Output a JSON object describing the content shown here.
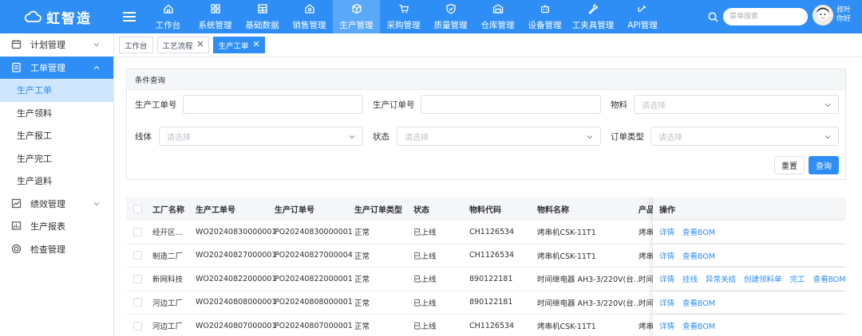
{
  "brand": {
    "name": "虹智造"
  },
  "nav": [
    {
      "label": "工作台",
      "icon": "home-icon"
    },
    {
      "label": "系统管理",
      "icon": "grid-icon"
    },
    {
      "label": "基础数据",
      "icon": "table-icon"
    },
    {
      "label": "销售管理",
      "icon": "store-icon"
    },
    {
      "label": "生产管理",
      "icon": "cube-icon"
    },
    {
      "label": "采购管理",
      "icon": "cart-icon"
    },
    {
      "label": "质量管理",
      "icon": "shield-icon"
    },
    {
      "label": "仓库管理",
      "icon": "warehouse-icon"
    },
    {
      "label": "设备管理",
      "icon": "robot-icon"
    },
    {
      "label": "工夹具管理",
      "icon": "wrench-icon"
    },
    {
      "label": "API管理",
      "icon": "satellite-icon"
    }
  ],
  "search": {
    "placeholder": "菜单搜索"
  },
  "user": {
    "line1": "叔叶",
    "line2": "你好"
  },
  "sidebar": {
    "groups": [
      {
        "label": "计划管理",
        "icon": "calendar-icon",
        "expandable": true
      },
      {
        "label": "工单管理",
        "icon": "document-icon",
        "expandable": true,
        "open": true,
        "children": [
          "生产工单",
          "生产领料",
          "生产报工",
          "生产完工",
          "生产退料"
        ]
      },
      {
        "label": "绩效管理",
        "icon": "chart-icon",
        "expandable": true
      },
      {
        "label": "生产报表",
        "icon": "report-icon",
        "expandable": false
      },
      {
        "label": "检查管理",
        "icon": "target-icon",
        "expandable": false
      }
    ]
  },
  "tabs": [
    {
      "label": "工作台",
      "closable": false,
      "active": false
    },
    {
      "label": "工艺流程",
      "closable": true,
      "active": false
    },
    {
      "label": "生产工单",
      "closable": true,
      "active": true
    }
  ],
  "filter": {
    "title": "条件查询",
    "work_order_label": "生产工单号",
    "prod_order_label": "生产订单号",
    "material_label": "物料",
    "material_placeholder": "请选择",
    "line_label": "线体",
    "line_placeholder": "请选择",
    "status_label": "状态",
    "status_placeholder": "请选择",
    "order_type_label": "订单类型",
    "order_type_placeholder": "请选择",
    "reset": "重置",
    "query": "查询"
  },
  "table": {
    "columns": [
      "工厂名称",
      "生产工单号",
      "生产订单号",
      "生产订单类型",
      "状态",
      "物料代码",
      "物料名称",
      "产品",
      "操作"
    ],
    "rows": [
      {
        "factory": "经开区...",
        "wo": "WO20240830000001",
        "po": "PO20240830000001",
        "type": "正常",
        "status": "已上线",
        "code": "CH1126534",
        "name": "烤串机CSK-11T1",
        "product": "烤串机",
        "actions": [
          "详情",
          "查看BOM"
        ]
      },
      {
        "factory": "制造二厂",
        "wo": "WO20240827000001",
        "po": "PO20240827000004",
        "type": "正常",
        "status": "已上线",
        "code": "CH1126534",
        "name": "烤串机CSK-11T1",
        "product": "烤串机",
        "actions": [
          "详情",
          "查看BOM"
        ]
      },
      {
        "factory": "新网科技",
        "wo": "WO20240822000001",
        "po": "PO20240822000001",
        "type": "正常",
        "status": "已上线",
        "code": "890122181",
        "name": "时间继电器 AH3-3/220V(台...",
        "product": "时间继",
        "actions": [
          "详情",
          "挂线",
          "异常关结",
          "创建领料单",
          "完工",
          "查看BOM"
        ]
      },
      {
        "factory": "河边工厂",
        "wo": "WO20240808000001",
        "po": "PO20240808000001",
        "type": "正常",
        "status": "已上线",
        "code": "890122181",
        "name": "时间继电器 AH3-3/220V(台...",
        "product": "时间继",
        "actions": [
          "详情",
          "查看BOM"
        ]
      },
      {
        "factory": "河边工厂",
        "wo": "WO20240807000001",
        "po": "PO20240807000001",
        "type": "正常",
        "status": "已上线",
        "code": "CH1126534",
        "name": "烤串机CSK-11T1",
        "product": "烤串机",
        "actions": [
          "详情",
          "查看BOM"
        ]
      }
    ]
  },
  "colors": {
    "primary": "#2f8ef5",
    "navActive": "#5aa8f8",
    "subActive": "#cfe6fd"
  }
}
